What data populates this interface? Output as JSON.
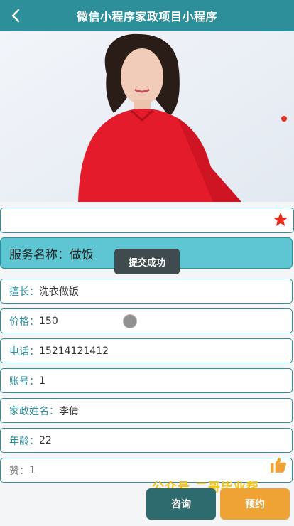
{
  "header": {
    "title": "微信小程序家政项目小程序"
  },
  "service": {
    "name_label": "服务名称：",
    "name_value": "做饭"
  },
  "toast": {
    "text": "提交成功"
  },
  "fields": [
    {
      "label": "擅长：",
      "value": "洗衣做饭"
    },
    {
      "label": "价格：",
      "value": "150"
    },
    {
      "label": "电话：",
      "value": "15214121412"
    },
    {
      "label": "账号：",
      "value": "1"
    },
    {
      "label": "家政姓名：",
      "value": "李倩"
    },
    {
      "label": "年龄：",
      "value": "22"
    }
  ],
  "likes": {
    "label": "赞：",
    "value": "1"
  },
  "watermark": {
    "text": "公众号 二哥毕业帮"
  },
  "actions": {
    "consult_label": "咨询",
    "book_label": "预约"
  },
  "colors": {
    "header_bg": "#2c8f99",
    "service_card_bg": "#5ec6d2",
    "consult_btn": "#2d6b6e",
    "book_btn": "#f0a335",
    "star": "#e52a1e",
    "watermark": "#f2c417"
  },
  "icons": {
    "back": "chevron-left-icon",
    "favorite": "star-icon",
    "like": "thumbs-up-icon"
  }
}
